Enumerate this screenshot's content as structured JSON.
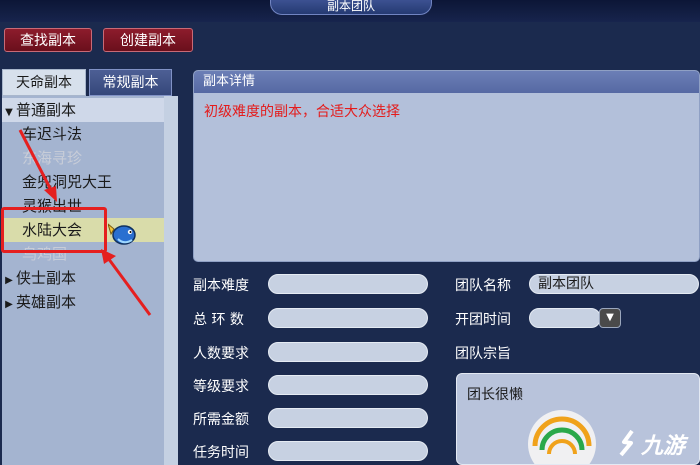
{
  "window": {
    "title": "副本团队"
  },
  "toolbar": {
    "find_label": "查找副本",
    "create_label": "创建副本"
  },
  "tabs": [
    {
      "label": "天命副本",
      "active": true
    },
    {
      "label": "常规副本",
      "active": false
    }
  ],
  "tree": {
    "categories": [
      {
        "label": "普通副本",
        "expanded": true
      },
      {
        "label": "侠士副本",
        "expanded": false
      },
      {
        "label": "英雄副本",
        "expanded": false
      }
    ],
    "items": [
      {
        "label": "车迟斗法",
        "state": "normal"
      },
      {
        "label": "东海寻珍",
        "state": "disabled"
      },
      {
        "label": "金兜洞兕大王",
        "state": "normal"
      },
      {
        "label": "灵猴出世",
        "state": "normal"
      },
      {
        "label": "水陆大会",
        "state": "highlighted"
      },
      {
        "label": "乌鸡国",
        "state": "disabled"
      }
    ]
  },
  "detail": {
    "header": "副本详情",
    "description": "初级难度的副本，合适大众选择"
  },
  "fields": {
    "difficulty_label": "副本难度",
    "difficulty_value": "",
    "rounds_label": "总 环 数",
    "rounds_value": "",
    "people_label": "人数要求",
    "people_value": "",
    "level_label": "等级要求",
    "level_value": "",
    "money_label": "所需金额",
    "money_value": "",
    "time_label": "任务时间",
    "time_value": "",
    "team_name_label": "团队名称",
    "team_name_value": "副本团队",
    "open_time_label": "开团时间",
    "open_time_value": "",
    "purpose_label": "团队宗旨",
    "purpose_value": "团长很懒"
  },
  "watermark": {
    "text": "九游"
  },
  "colors": {
    "accent_red": "#e51f1f",
    "button_red": "#7a1624",
    "panel_bg": "#1b2a4e",
    "field_bg": "#c7d1e2"
  }
}
